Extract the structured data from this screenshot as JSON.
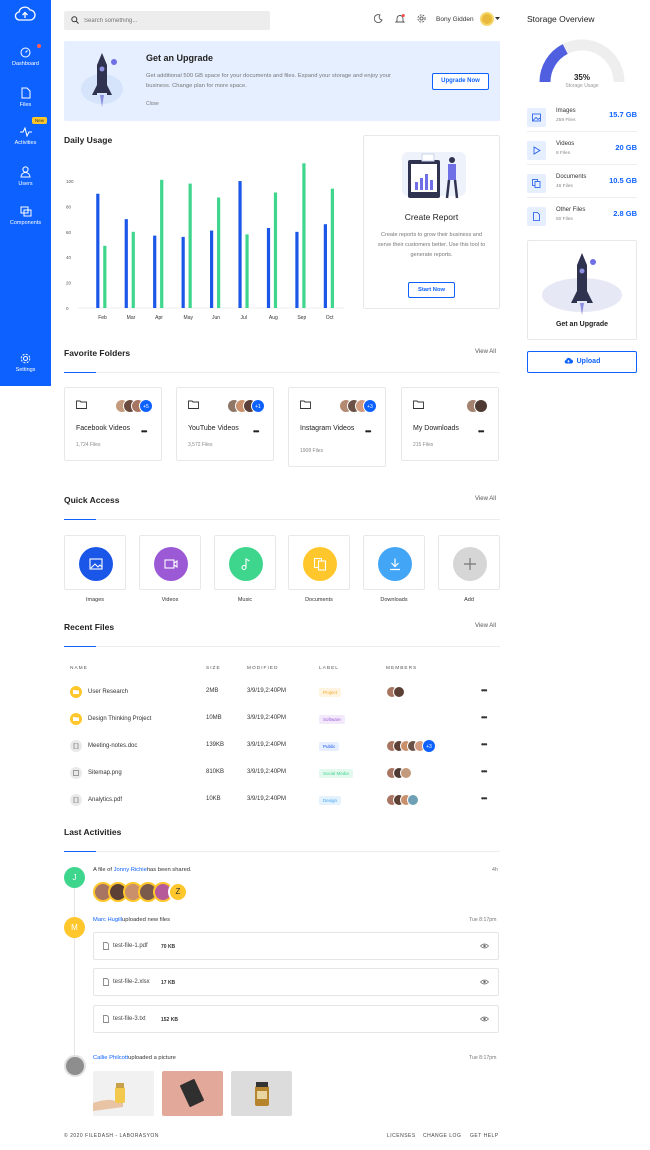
{
  "sidebar": {
    "items": [
      {
        "label": "Dashboard",
        "icon": "dashboard-icon"
      },
      {
        "label": "Files",
        "icon": "files-icon"
      },
      {
        "label": "Activities",
        "icon": "activities-icon",
        "badge": "New"
      },
      {
        "label": "Users",
        "icon": "users-icon"
      },
      {
        "label": "Components",
        "icon": "components-icon"
      }
    ],
    "settings_label": "Settings"
  },
  "header": {
    "search_placeholder": "Search something...",
    "user_name": "Bony Gidden"
  },
  "upgrade_banner": {
    "title": "Get an Upgrade",
    "text": "Get additional 500 GB space for your documents and files. Expand your storage and enjoy your business. Change plan for more space.",
    "close_label": "Close",
    "button_label": "Upgrade Now"
  },
  "daily_usage": {
    "title": "Daily Usage"
  },
  "chart_data": {
    "type": "bar",
    "title": "Daily Usage",
    "categories": [
      "Feb",
      "Mar",
      "Apr",
      "May",
      "Jun",
      "Jul",
      "Aug",
      "Sep",
      "Oct"
    ],
    "series": [
      {
        "color": "#1a56e8",
        "values": [
          90,
          70,
          57,
          56,
          61,
          100,
          63,
          60,
          66
        ]
      },
      {
        "color": "#3dd68c",
        "values": [
          49,
          60,
          101,
          98,
          87,
          58,
          91,
          114,
          94
        ]
      }
    ],
    "yticks": [
      0,
      10,
      20,
      30,
      40,
      50,
      60,
      70,
      80,
      90,
      100
    ],
    "ylim": [
      0,
      100
    ],
    "grid": false
  },
  "create_report": {
    "title": "Create Report",
    "text": "Create reports to grow their business and serve their customers better. Use this tool to generate reports.",
    "button_label": "Start Now"
  },
  "favorite_folders": {
    "title": "Favorite Folders",
    "view_all": "View All",
    "folders": [
      {
        "name": "Facebook Videos",
        "count": "1,724 Files",
        "more": "+5"
      },
      {
        "name": "YouTube Videos",
        "count": "3,572 Files",
        "more": "+1"
      },
      {
        "name": "Instagram Videos",
        "count": "1908 Files",
        "more": "+3"
      },
      {
        "name": "My Downloads",
        "count": "215 Files",
        "more": ""
      }
    ]
  },
  "quick_access": {
    "title": "Quick Access",
    "view_all": "View All",
    "items": [
      {
        "label": "Images",
        "color": "#1a56e8",
        "icon": "image-icon"
      },
      {
        "label": "Videos",
        "color": "#9b59d6",
        "icon": "video-icon"
      },
      {
        "label": "Music",
        "color": "#3dd68c",
        "icon": "music-icon"
      },
      {
        "label": "Documents",
        "color": "#ffc72c",
        "icon": "documents-icon"
      },
      {
        "label": "Downloads",
        "color": "#42a5f5",
        "icon": "download-icon"
      },
      {
        "label": "Add",
        "color": "#d6d6d6",
        "icon": "plus-icon"
      }
    ]
  },
  "recent_files": {
    "title": "Recent Files",
    "view_all": "View All",
    "columns": [
      "NAME",
      "SIZE",
      "MODIFIED",
      "LABEL",
      "MEMBERS"
    ],
    "rows": [
      {
        "name": "User Research",
        "size": "2MB",
        "modified": "3/9/19,2:40PM",
        "label": "Project",
        "label_color": "#f5a623",
        "label_bg": "#fff4e0",
        "icon_color": "#ffc72c",
        "members_more": ""
      },
      {
        "name": "Design Thinking Project",
        "size": "10MB",
        "modified": "3/9/19,2:40PM",
        "label": "Software",
        "label_color": "#9b59d6",
        "label_bg": "#f3e9fb",
        "icon_color": "#ffc72c",
        "members_more": ""
      },
      {
        "name": "Meeting-notes.doc",
        "size": "139KB",
        "modified": "3/9/19,2:40PM",
        "label": "Public",
        "label_color": "#1a56e8",
        "label_bg": "#e6efff",
        "icon_color": "#e9e9e9",
        "members_more": "+3"
      },
      {
        "name": "Sitemap.png",
        "size": "810KB",
        "modified": "3/9/19,2:40PM",
        "label": "Social Media",
        "label_color": "#3dd68c",
        "label_bg": "#e3f9ee",
        "icon_color": "#e9e9e9",
        "members_more": ""
      },
      {
        "name": "Analytics.pdf",
        "size": "10KB",
        "modified": "3/9/19,2:40PM",
        "label": "Design",
        "label_color": "#42a5f5",
        "label_bg": "#e4f2fd",
        "icon_color": "#e9e9e9",
        "members_more": ""
      }
    ]
  },
  "last_activities": {
    "title": "Last Activities",
    "items": [
      {
        "initial": "J",
        "color": "#3dd68c",
        "prefix": "A file of ",
        "link": "Jonny Richie",
        "suffix": "has been shared.",
        "time": "4h"
      },
      {
        "initial": "M",
        "color": "#ffc72c",
        "link": "Marc Hugill",
        "suffix": "uploaded new files",
        "time": "Tue 8:17pm",
        "files": [
          {
            "name": "test-file-1.pdf",
            "size": "70 KB"
          },
          {
            "name": "test-file-2.xlsx",
            "size": "17 KB"
          },
          {
            "name": "test-file-3.txt",
            "size": "152 KB"
          }
        ]
      },
      {
        "initial": "",
        "color": "#cccccc",
        "link": "Callie Philcott",
        "suffix": "uploaded a picture",
        "time": "Tue 8:17pm"
      }
    ],
    "shared_last_initial": "Z"
  },
  "footer": {
    "copyright": "© 2020 FILEDASH - LABORASYON",
    "links": [
      "LICENSES",
      "CHANGE LOG",
      "GET HELP"
    ]
  },
  "storage": {
    "title": "Storage Overview",
    "percent": "35%",
    "percent_value": 0.35,
    "caption": "Storage Usage",
    "items": [
      {
        "name": "Images",
        "count": "259 Files",
        "size": "15.7 GB",
        "icon": "image-icon"
      },
      {
        "name": "Videos",
        "count": "8 Files",
        "size": "20 GB",
        "icon": "play-icon"
      },
      {
        "name": "Documents",
        "count": "46 Files",
        "size": "10.5 GB",
        "icon": "documents-icon"
      },
      {
        "name": "Other Files",
        "count": "50 Files",
        "size": "2.8 GB",
        "icon": "file-icon"
      }
    ],
    "upgrade_card_title": "Get an Upgrade",
    "upload_label": "Upload"
  }
}
